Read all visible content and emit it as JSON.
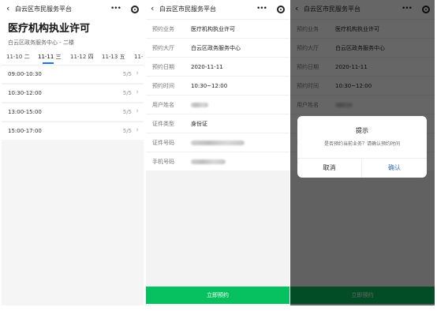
{
  "navbar": {
    "back_icon": "chevron-left",
    "title": "白云区市民服务平台",
    "more_icon": "more-dots",
    "close_icon": "target-circle",
    "more_text": "•••"
  },
  "screen1": {
    "title": "医疗机构执业许可",
    "hall": "白云区政务服务中心 - 二楼",
    "date_tabs": [
      "11-10 二",
      "11-11 三",
      "11-12 四",
      "11-13 五",
      "11-1("
    ],
    "active_tab": 1,
    "slots": [
      {
        "time": "09:00-10:30",
        "count": "5/5"
      },
      {
        "time": "10:30-12:00",
        "count": "5/5"
      },
      {
        "time": "13:00-15:00",
        "count": "5/5"
      },
      {
        "time": "15:00-17:00",
        "count": "5/5"
      }
    ],
    "arrow": "›"
  },
  "screen2": {
    "rows": [
      {
        "label": "预约业务",
        "value": "医疗机构执业许可"
      },
      {
        "label": "预约大厅",
        "value": "白云区政务服务中心"
      },
      {
        "label": "预约日期",
        "value": "2020-11-11"
      },
      {
        "label": "预约时间",
        "value": "10:30~12:00"
      },
      {
        "label": "用户姓名",
        "value": ""
      },
      {
        "label": "证件类型",
        "value": "身份证"
      },
      {
        "label": "证件号码",
        "value": ""
      },
      {
        "label": "手机号码",
        "value": ""
      }
    ],
    "submit": "立即预约"
  },
  "screen3": {
    "dialog": {
      "title": "提示",
      "message": "是否预约当前业务？请确认预约时间",
      "cancel": "取消",
      "confirm": "确认"
    }
  },
  "colors": {
    "accent": "#07c160",
    "tab_underline": "#1a73e8",
    "confirm_text": "#3b6fb6"
  }
}
